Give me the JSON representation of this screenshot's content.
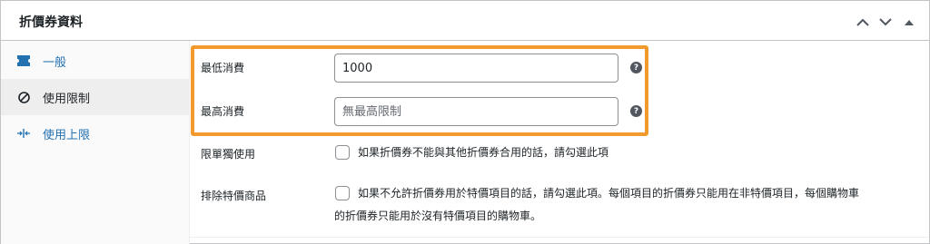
{
  "header": {
    "title": "折價券資料",
    "up_icon": "chevron-up-icon",
    "down_icon": "chevron-down-icon",
    "toggle_icon": "triangle-up-icon"
  },
  "tabs": [
    {
      "label": "一般",
      "icon": "ticket-icon",
      "state": "link"
    },
    {
      "label": "使用限制",
      "icon": "no-symbol-icon",
      "state": "active"
    },
    {
      "label": "使用上限",
      "icon": "arrows-in-icon",
      "state": "link"
    }
  ],
  "fields": {
    "min_spend": {
      "label": "最低消費",
      "value": "1000",
      "placeholder": ""
    },
    "max_spend": {
      "label": "最高消費",
      "value": "",
      "placeholder": "無最高限制"
    },
    "individual_use": {
      "label": "限單獨使用",
      "description": "如果折價券不能與其他折價券合用的話，請勾選此項",
      "checked": false
    },
    "exclude_sale": {
      "label": "排除特價商品",
      "description_line1": "如果不允許折價券用於特價項目的話，請勾選此項。每個項目的折價券只能用在非特價項目，每個購物車",
      "description_line2": "的折價券只能用於沒有特價項目的購物車。",
      "checked": false
    }
  },
  "colors": {
    "highlight": "#f29a2e",
    "link": "#2271b1",
    "active_tab": "#eeeeee"
  }
}
